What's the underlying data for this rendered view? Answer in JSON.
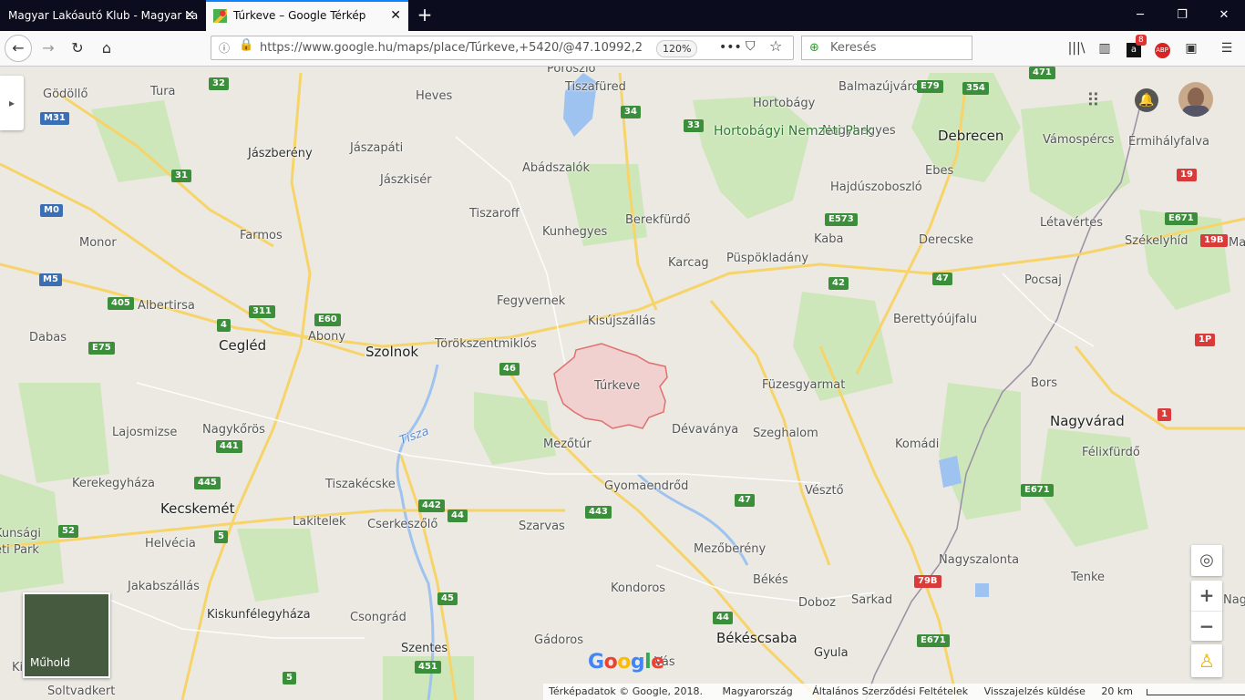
{
  "tabs": [
    {
      "title": "Magyar Lakóautó Klub - Magyar La",
      "active": false
    },
    {
      "title": "Túrkeve – Google Térkép",
      "active": true
    }
  ],
  "url": "https://www.google.hu/maps/place/Túrkeve,+5420/@47.10992,2",
  "zoom_level": "120%",
  "search_placeholder": "Keresés",
  "badge_count": "8",
  "abp_label": "ABP",
  "satellite_label": "Műhold",
  "google_logo": "Google",
  "attribution": {
    "map_data": "Térképadatok © Google, 2018.",
    "country": "Magyarország",
    "terms": "Általános Szerződési Feltételek",
    "feedback": "Visszajelzés küldése",
    "scale": "20 km"
  },
  "park_label": "Hortobágyi Nemzeti Park",
  "selected_place": "Túrkeve",
  "places": [
    "Gödöllő",
    "Tura",
    "Heves",
    "Poroszló",
    "Tiszafüred",
    "Hortobágy",
    "Balmazújváros",
    "Debrecen",
    "Vámospércs",
    "Érmihályfalva",
    "Jászberény",
    "Jászapáti",
    "Nagyhegyes",
    "Ebes",
    "Hajdúszoboszló",
    "Jászkisér",
    "Abádszalók",
    "Tiszaroff",
    "Berekfürdő",
    "Kunhegyes",
    "Monor",
    "Farmos",
    "Kaba",
    "Derecske",
    "Létavértes",
    "Székelyhíd",
    "Püspökladány",
    "Karcag",
    "Pocsaj",
    "Albertirsa",
    "Fegyvernek",
    "Kisújszállás",
    "Berettyóújfalu",
    "Dabas",
    "Cegléd",
    "Abony",
    "Szolnok",
    "Törökszentmiklós",
    "Füzesgyarmat",
    "Bors",
    "Nagyvárad",
    "Lajosmizse",
    "Nagykőrös",
    "Dévaványa",
    "Szeghalom",
    "Komádi",
    "Félixfürdő",
    "Mezőtúr",
    "Kerekegyháza",
    "Tiszakécske",
    "Gyomaendrőd",
    "Vésztő",
    "Kecskemét",
    "Lakitelek",
    "Cserkeszőlő",
    "Szarvas",
    "Helvécia",
    "Mezőberény",
    "Nagyszalonta",
    "Tenke",
    "Jakabszállás",
    "Békés",
    "Kondoros",
    "Sarkad",
    "Doboz",
    "Kiskunfélegyháza",
    "Csongrád",
    "Szentes",
    "Gádoros",
    "Békéscsaba",
    "Gyula",
    "Soltvadkert",
    "Ma",
    "Kunsági",
    "eti Park",
    "Ki",
    "Nagy",
    "Vás"
  ],
  "route_numbers": [
    "32",
    "34",
    "33",
    "E79",
    "354",
    "471",
    "M31",
    "31",
    "E573",
    "M0",
    "E671",
    "19B",
    "M5",
    "405",
    "311",
    "E60",
    "4",
    "42",
    "47",
    "1P",
    "E75",
    "46",
    "441",
    "1",
    "445",
    "442",
    "E671",
    "44",
    "443",
    "52",
    "5",
    "79B",
    "45",
    "451",
    "E671",
    "5",
    "44",
    "47",
    "19"
  ],
  "colors": {
    "active_tab_border": "#0a84ff",
    "park": "#2d7d2d",
    "road_major": "#f7d46a",
    "water": "#9ec3f0",
    "highlight": "#e8a0a0"
  }
}
